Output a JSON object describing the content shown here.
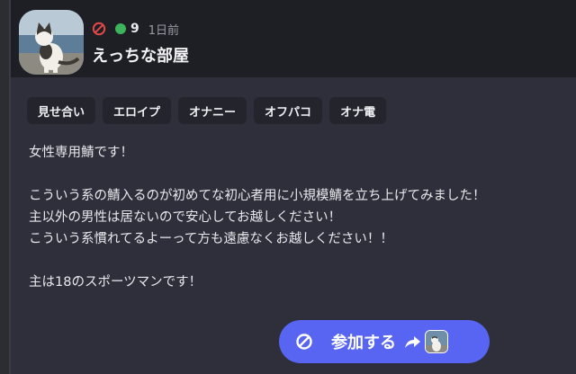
{
  "server": {
    "name": "えっちな部屋",
    "online_count": "9",
    "posted": "1日前"
  },
  "tags": [
    "見せ合い",
    "エロイプ",
    "オナニー",
    "オフパコ",
    "オナ電"
  ],
  "description": [
    "女性専用鯖です！",
    "",
    "こういう系の鯖入るのが初めてな初心者用に小規模鯖を立ち上げてみました！",
    "主以外の男性は居ないので安心してお越しください！",
    "こういう系慣れてるよーって方も遠慮なくお越しください！！",
    "",
    "主は18のスポーツマンです！"
  ],
  "join_button": {
    "label": "参加する"
  },
  "colors": {
    "accent": "#5865f2",
    "online": "#3fb25c",
    "ban": "#e04848"
  }
}
